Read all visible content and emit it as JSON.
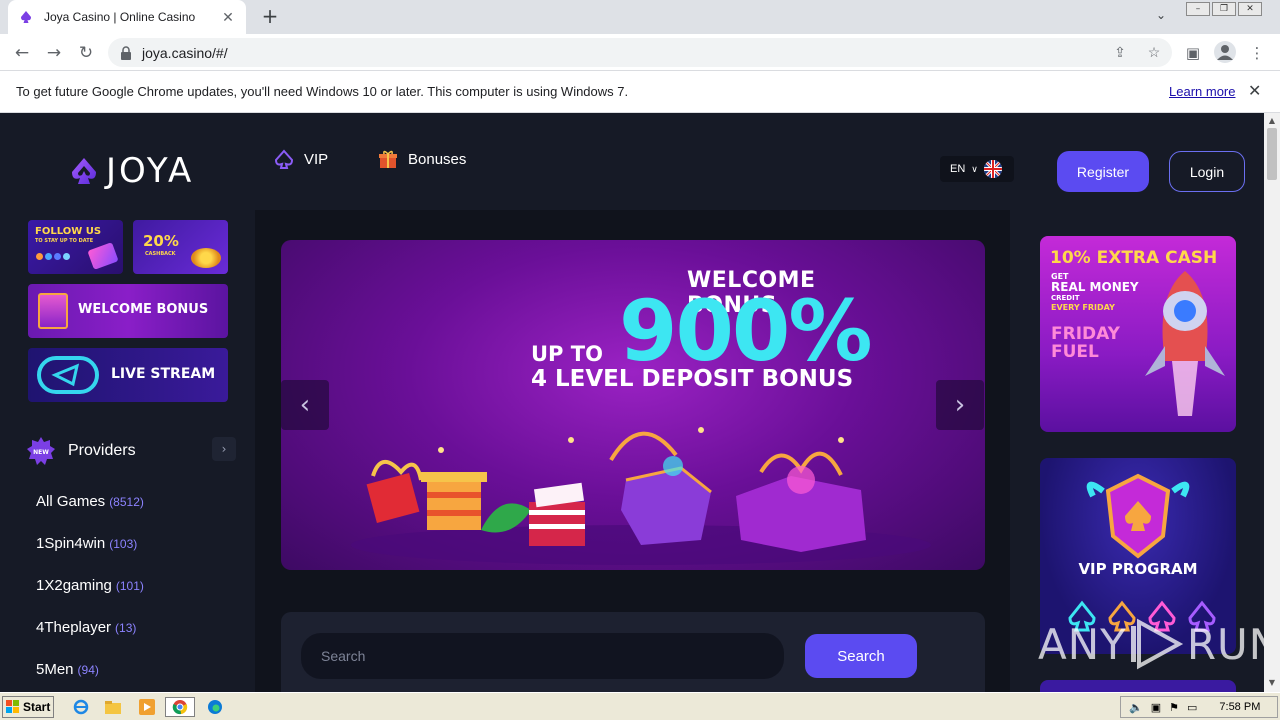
{
  "browser": {
    "tab_title": "Joya Casino | Online Casino",
    "url": "joya.casino/#/",
    "infobar_message": "To get future Google Chrome updates, you'll need Windows 10 or later. This computer is using Windows 7.",
    "infobar_link": "Learn more"
  },
  "header": {
    "logo_text": "JOYA",
    "nav": [
      {
        "label": "VIP"
      },
      {
        "label": "Bonuses"
      }
    ],
    "language": "EN",
    "register_label": "Register",
    "login_label": "Login"
  },
  "sidebar": {
    "promos": {
      "follow": "FOLLOW US",
      "follow_sub": "TO STAY UP TO DATE",
      "cashback": "20%",
      "cashback_sub": "CASHBACK",
      "welcome": "WELCOME BONUS",
      "livestream": "LIVE STREAM"
    },
    "providers_badge": "NEW",
    "providers_title": "Providers",
    "providers": [
      {
        "name": "All Games",
        "count": "(8512)"
      },
      {
        "name": "1Spin4win",
        "count": "(103)"
      },
      {
        "name": "1X2gaming",
        "count": "(101)"
      },
      {
        "name": "4Theplayer",
        "count": "(13)"
      },
      {
        "name": "5Men",
        "count": "(94)"
      }
    ]
  },
  "hero": {
    "line1": "WELCOME BONUS",
    "line2": "900%",
    "line3": "UP TO",
    "line4": "4 LEVEL DEPOSIT BONUS"
  },
  "search": {
    "placeholder": "Search",
    "button_label": "Search"
  },
  "right_promos": {
    "friday_title": "10% EXTRA CASH",
    "friday_get": "GET",
    "friday_money": "REAL MONEY",
    "friday_credit": "CREDIT",
    "friday_every": "EVERY FRIDAY",
    "friday_fuel_1": "FRIDAY",
    "friday_fuel_2": "FUEL",
    "vip_title": "VIP PROGRAM"
  },
  "watermark": {
    "left": "ANY",
    "right": "RUN"
  },
  "taskbar": {
    "start_label": "Start",
    "clock": "7:58 PM"
  },
  "colors": {
    "accent": "#5b4bf1",
    "background": "#161a26",
    "hero_cyan": "#3de6f2"
  }
}
